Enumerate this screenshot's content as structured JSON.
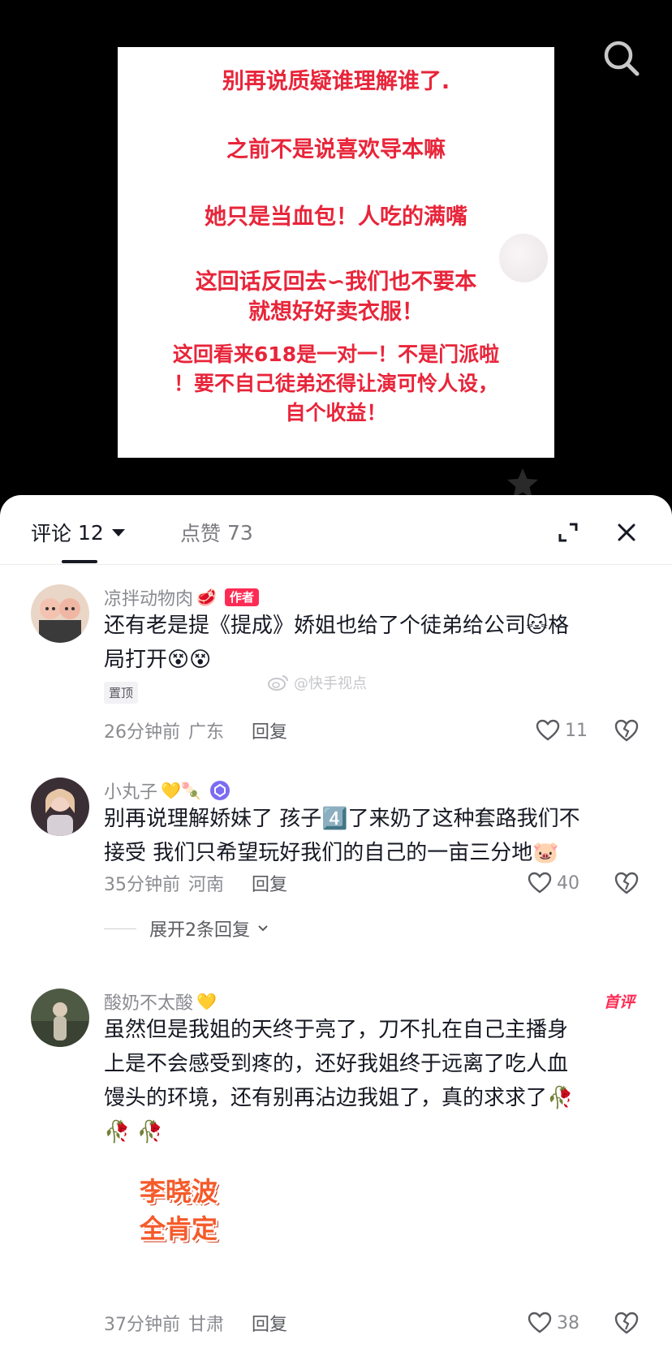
{
  "poster": {
    "lines": [
      "别再说质疑谁理解谁了.",
      "之前不是说喜欢导本嘛",
      "她只是当血包！人吃的满嘴",
      "这回话反回去∽我们也不要本",
      "就想好好卖衣服！",
      "这回看来618是一对一！不是门派啦",
      "！要不自己徒弟还得让演可怜人设，",
      "自个收益！"
    ]
  },
  "tabs": {
    "comments_label": "评论",
    "comments_count": "12",
    "likes_label": "点赞",
    "likes_count": "73"
  },
  "watermark": "@快手视点",
  "comments": [
    {
      "username": "凉拌动物肉",
      "user_emoji": "🥩",
      "badge": "作者",
      "text_lines": [
        "还有老是提《提成》娇姐也给了个徒弟给公司🐱格",
        "局打开😵😵"
      ],
      "pin": "置顶",
      "time": "26分钟前",
      "location": "广东",
      "reply": "回复",
      "likes": "11"
    },
    {
      "username": "小丸子",
      "user_emoji": "💛🍡",
      "text_lines": [
        "别再说理解娇妹了 孩子4️⃣了来奶了这种套路我们不",
        "接受 我们只希望玩好我们的自己的一亩三分地🐷"
      ],
      "time": "35分钟前",
      "location": "河南",
      "reply": "回复",
      "likes": "40",
      "expand": "展开2条回复"
    },
    {
      "username": "酸奶不太酸",
      "user_emoji": "💛",
      "first_badge": "首评",
      "text_lines": [
        "虽然但是我姐的天终于亮了，刀不扎在自己主播身",
        "上是不会感受到疼的，还好我姐终于远离了吃人血",
        "馒头的环境，还有别再沾边我姐了，真的求求了🥀",
        "🥀 🥀"
      ],
      "sticker_lines": [
        "李晓波",
        "全肯定"
      ],
      "time": "37分钟前",
      "location": "甘肃",
      "reply": "回复",
      "likes": "38"
    }
  ],
  "icons": {
    "search": "search-icon",
    "star": "star-icon",
    "expand": "expand-icon",
    "close": "close-icon",
    "like": "heart-icon",
    "dislike": "broken-heart-icon"
  },
  "colors": {
    "poster_text": "#e8253a",
    "author_badge": "#fe2c55",
    "text_primary": "#161823",
    "text_secondary": "#8a8b90"
  }
}
